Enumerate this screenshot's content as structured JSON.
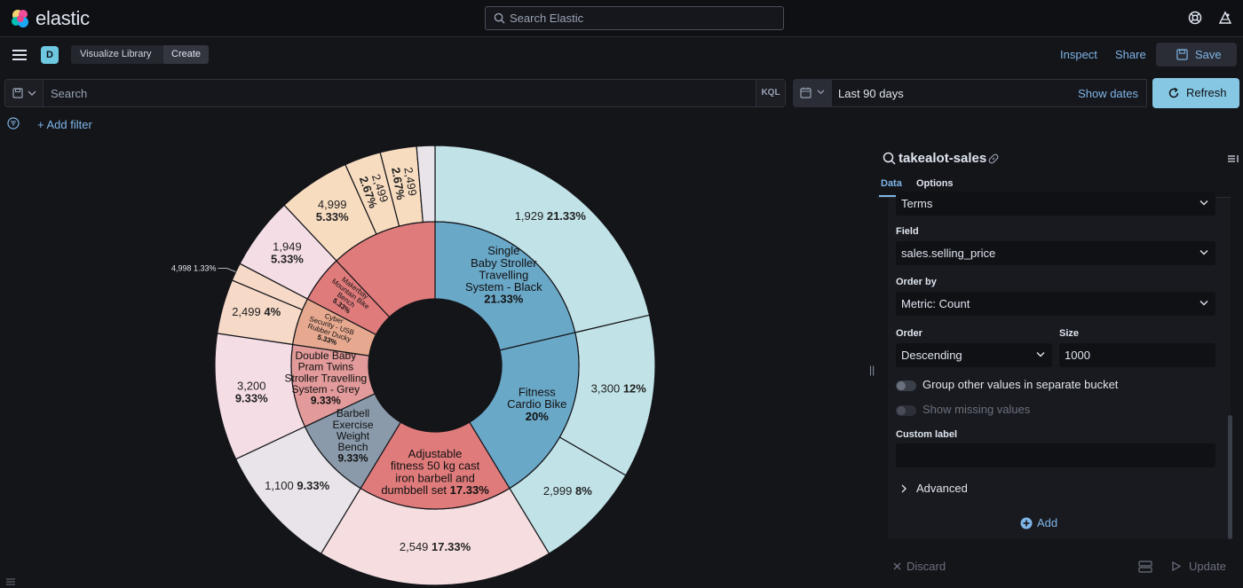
{
  "header": {
    "brand": "elastic",
    "search_placeholder": "Search Elastic"
  },
  "appbar": {
    "space_initial": "D",
    "breadcrumbs": [
      "Visualize Library",
      "Create"
    ],
    "inspect_label": "Inspect",
    "share_label": "Share",
    "save_label": "Save"
  },
  "querybar": {
    "search_placeholder": "Search",
    "language": "KQL",
    "date_range": "Last 90 days",
    "show_dates_label": "Show dates",
    "refresh_label": "Refresh"
  },
  "filterbar": {
    "add_filter_label": "+ Add filter"
  },
  "panel": {
    "index_title": "takealot-sales",
    "tabs": [
      "Data",
      "Options"
    ],
    "aggregation_value": "Terms",
    "field_label": "Field",
    "field_value": "sales.selling_price",
    "order_by_label": "Order by",
    "order_by_value": "Metric: Count",
    "order_label": "Order",
    "order_value": "Descending",
    "size_label": "Size",
    "size_value": "1000",
    "group_other_label": "Group other values in separate bucket",
    "show_missing_label": "Show missing values",
    "custom_label_label": "Custom label",
    "advanced_label": "Advanced",
    "add_label": "Add",
    "discard_label": "Discard",
    "update_label": "Update"
  },
  "chart_data": {
    "type": "pie",
    "donut": true,
    "inner_ring": [
      {
        "label": [
          "Single",
          "Baby Stroller",
          "Travelling",
          "System - Black"
        ],
        "pct": "21.33%",
        "value": 21.33,
        "color": "#6aa8c8"
      },
      {
        "label": [
          "Fitness",
          "Cardio Bike"
        ],
        "pct": "20%",
        "value": 20.0,
        "color": "#6aa8c8"
      },
      {
        "label": [
          "Adjustable",
          "fitness 50 kg cast",
          "iron barbell and"
        ],
        "label_last": "dumbbell set",
        "pct": "17.33%",
        "value": 17.33,
        "color": "#e07b7b"
      },
      {
        "label": [
          "Barbell",
          "Exercise",
          "Weight",
          "Bench"
        ],
        "pct": "9.33%",
        "value": 9.33,
        "color": "#8a9aab"
      },
      {
        "label": [
          "Double Baby",
          "Pram Twins",
          "Stroller Travelling",
          "System - Grey"
        ],
        "pct": "9.33%",
        "value": 9.33,
        "color": "#e29a9a"
      },
      {
        "label": [
          "Cyber",
          "Security - USB",
          "Rubber Ducky"
        ],
        "pct": "5.33%",
        "value": 5.33,
        "color": "#e6a98f"
      },
      {
        "label": [
          "Makerbay",
          "Mountain Bike",
          "Bench"
        ],
        "pct": "5.33%",
        "value": 5.33,
        "color": "#e07b7b"
      },
      {
        "label": [],
        "pct": "",
        "value": 12.02,
        "color": "#e07b7b"
      }
    ],
    "outer_ring": [
      {
        "value_label": "1,929",
        "pct": "21.33%",
        "value": 21.33,
        "color": "#c1e3e8"
      },
      {
        "value_label": "3,300",
        "pct": "12%",
        "value": 12.0,
        "color": "#c1e3e8"
      },
      {
        "value_label": "2,999",
        "pct": "8%",
        "value": 8.0,
        "color": "#c1e3e8"
      },
      {
        "value_label": "2,549",
        "pct": "17.33%",
        "value": 17.33,
        "color": "#f5dde0"
      },
      {
        "value_label": "1,100",
        "pct": "9.33%",
        "value": 9.33,
        "color": "#e8e4ea"
      },
      {
        "value_label": "3,200",
        "pct": "9.33%",
        "value": 9.33,
        "color": "#f5dde6"
      },
      {
        "value_label": "2,499",
        "pct": "4%",
        "value": 4.0,
        "color": "#f6d9c7"
      },
      {
        "value_label": "4,998",
        "pct": "1.33%",
        "value": 1.33,
        "color": "#f6d9c7"
      },
      {
        "value_label": "1,949",
        "pct": "5.33%",
        "value": 5.33,
        "color": "#f5dde6"
      },
      {
        "value_label": "4,999",
        "pct": "5.33%",
        "value": 5.33,
        "color": "#f8dcc0"
      },
      {
        "value_label": "2,499",
        "pct": "2.67%",
        "value": 2.67,
        "color": "#f8dcc0"
      },
      {
        "value_label": "2,499",
        "pct": "2.67%",
        "value": 2.67,
        "color": "#f8dcc0"
      },
      {
        "value_label": "",
        "pct": "",
        "value": 1.34,
        "color": "#e8e4ea"
      }
    ]
  }
}
